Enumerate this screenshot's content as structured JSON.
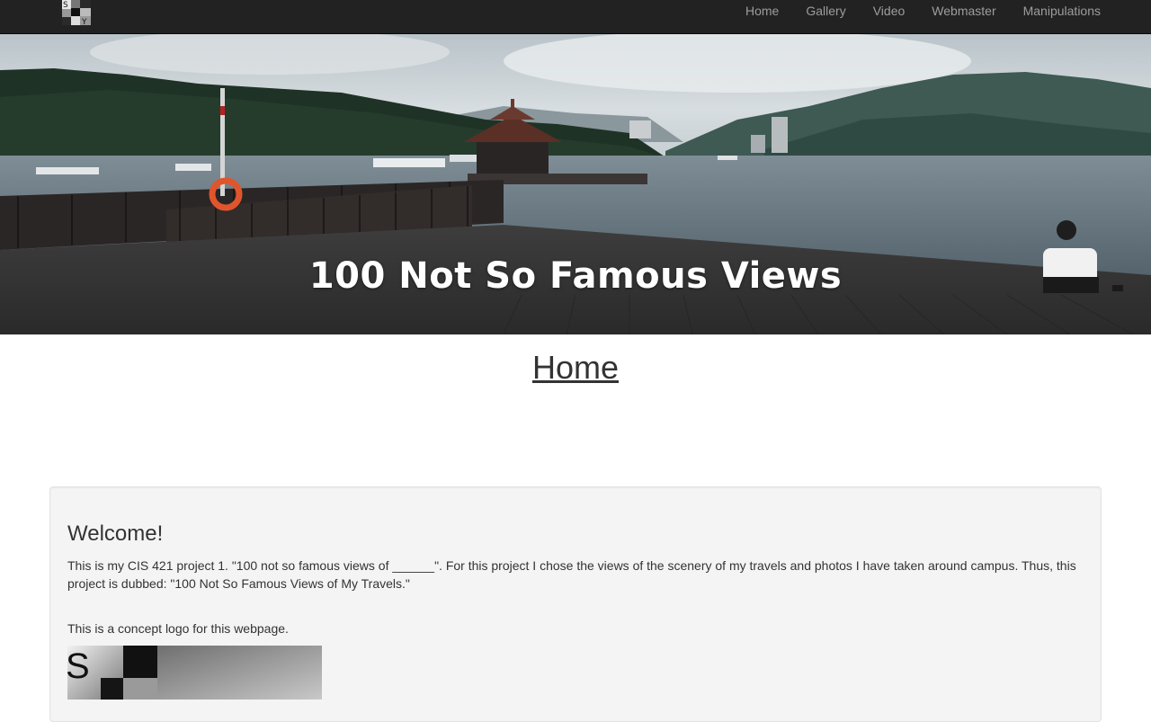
{
  "nav": {
    "brand_letters": [
      "S",
      "Y"
    ],
    "items": [
      {
        "label": "Home"
      },
      {
        "label": "Gallery"
      },
      {
        "label": "Video"
      },
      {
        "label": "Webmaster"
      },
      {
        "label": "Manipulations"
      }
    ]
  },
  "hero": {
    "title": "100 Not So Famous Views"
  },
  "page": {
    "heading": "Home"
  },
  "welcome": {
    "title": "Welcome!",
    "intro": "This is my CIS 421 project 1. \"100 not so famous views of ______\". For this project I chose the views of the scenery of my travels and photos I have taken around campus. Thus, this project is dubbed: \"100 Not So Famous Views of My Travels.\"",
    "logo_caption": "This is a concept logo for this webpage.",
    "logo_letter": "S"
  },
  "colors": {
    "navbar_bg": "#222222",
    "nav_link": "#9d9d9d",
    "well_bg": "#f4f4f4",
    "text": "#333333"
  }
}
